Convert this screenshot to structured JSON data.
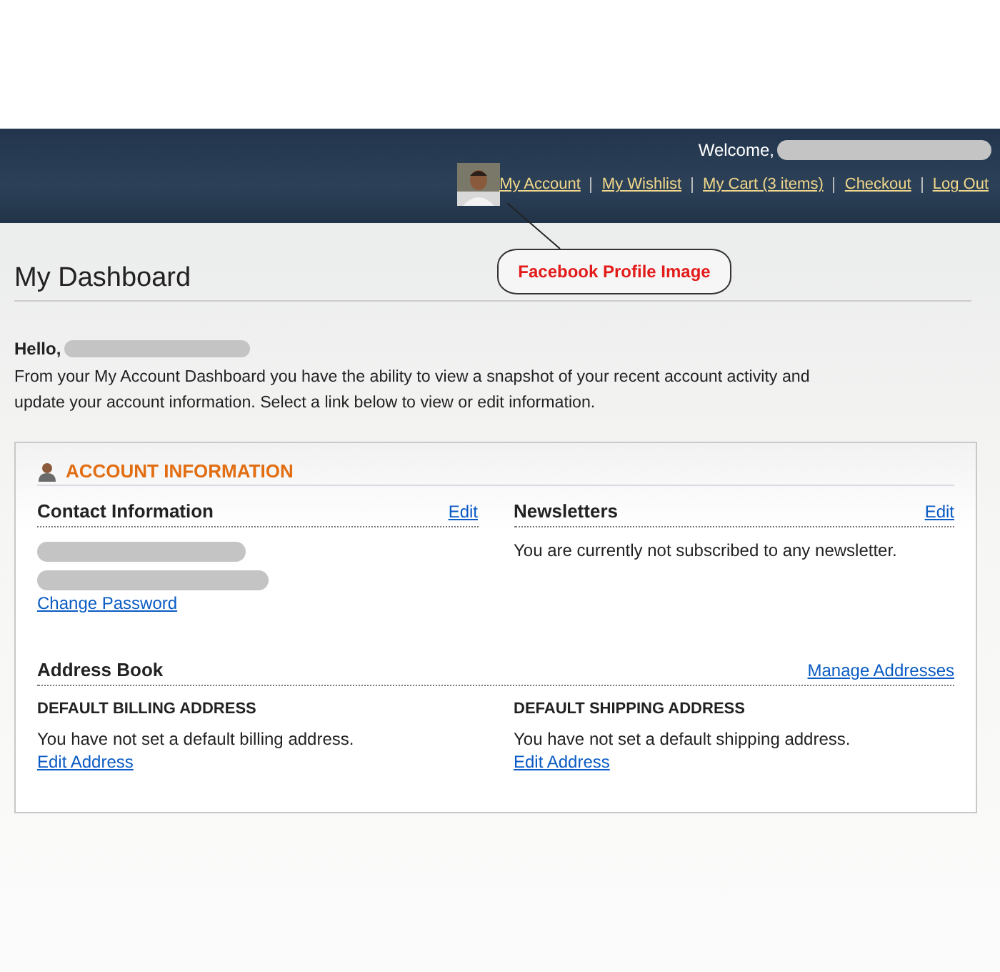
{
  "header": {
    "welcome": "Welcome,",
    "links": [
      {
        "label": "My Account"
      },
      {
        "label": "My Wishlist"
      },
      {
        "label": "My Cart (3 items)"
      },
      {
        "label": "Checkout"
      },
      {
        "label": "Log Out"
      }
    ],
    "callout": "Facebook Profile Image"
  },
  "page_title": "My Dashboard",
  "greeting": "Hello,",
  "intro": "From your My Account Dashboard you have the ability to view a snapshot of your recent account activity and update your account information. Select a link below to view or edit information.",
  "account_information": {
    "title": "ACCOUNT INFORMATION",
    "contact": {
      "title": "Contact Information",
      "edit": "Edit",
      "change_password": "Change Password"
    },
    "newsletters": {
      "title": "Newsletters",
      "edit": "Edit",
      "text": "You are currently not subscribed to any newsletter."
    },
    "address_book": {
      "title": "Address Book",
      "manage": "Manage Addresses",
      "addresses": [
        {
          "title": "DEFAULT BILLING ADDRESS",
          "text": "You have not set a default billing address.",
          "link": "Edit Address"
        },
        {
          "title": "DEFAULT SHIPPING ADDRESS",
          "text": "You have not set a default shipping address.",
          "link": "Edit Address"
        }
      ]
    }
  }
}
